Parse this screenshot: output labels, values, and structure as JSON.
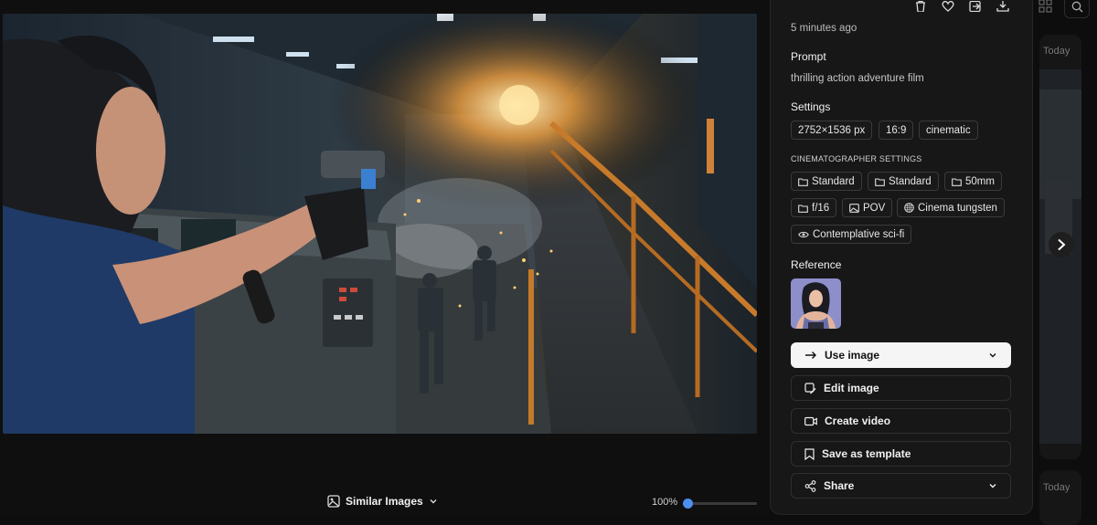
{
  "panel": {
    "time": "5 minutes ago",
    "prompt_heading": "Prompt",
    "prompt_text": "thrilling action adventure film",
    "settings_heading": "Settings",
    "settings": [
      "2752×1536 px",
      "16:9",
      "cinematic"
    ],
    "cinematographer_heading": "CINEMATOGRAPHER SETTINGS",
    "cinematographer": [
      {
        "label": "Standard",
        "icon": "folder-icon"
      },
      {
        "label": "Standard",
        "icon": "folder-icon"
      },
      {
        "label": "50mm",
        "icon": "folder-icon"
      },
      {
        "label": "f/16",
        "icon": "folder-icon"
      },
      {
        "label": "POV",
        "icon": "image-icon"
      },
      {
        "label": "Cinema tungsten",
        "icon": "grid-icon"
      },
      {
        "label": "Contemplative sci-fi",
        "icon": "eye-icon"
      }
    ],
    "reference_heading": "Reference",
    "buttons": {
      "use_image": "Use image",
      "edit_image": "Edit image",
      "create_video": "Create video",
      "save_template": "Save as template",
      "share": "Share"
    },
    "top_icons": [
      "trash-icon",
      "heart-icon",
      "export-icon",
      "download-icon"
    ]
  },
  "bottom": {
    "similar_images": "Similar Images",
    "zoom": "100%",
    "zoom_fraction": 0.0
  },
  "right_edge": {
    "today_label_1": "Today",
    "today_label_2": "Today"
  },
  "colors": {
    "background": "#0d0d0d",
    "panel": "#171717",
    "accent": "#4d8ff0",
    "primary_button": "#f5f5f5"
  }
}
